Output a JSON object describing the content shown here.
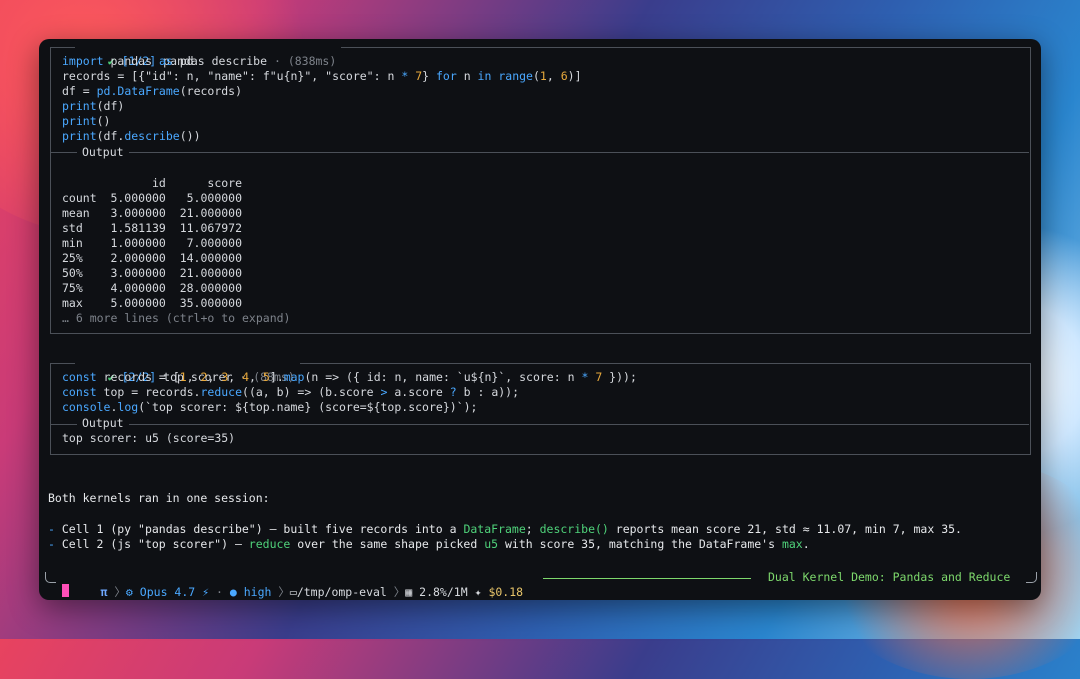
{
  "cell1": {
    "check": "✔",
    "step": "[1/2]",
    "title": "pandas describe",
    "dot": "·",
    "time": "(838ms)",
    "output_label": "Output",
    "code": [
      [
        [
          "import",
          "kw"
        ],
        [
          " pandas ",
          ""
        ],
        [
          "as",
          "kw"
        ],
        [
          " pd",
          ""
        ]
      ],
      [
        [
          "records = [{",
          ""
        ],
        [
          "\"id\"",
          ""
        ],
        [
          ": n, ",
          ""
        ],
        [
          "\"name\"",
          ""
        ],
        [
          ": f\"u{n}\", ",
          ""
        ],
        [
          "\"score\"",
          ""
        ],
        [
          ": n ",
          ""
        ],
        [
          "*",
          "kw"
        ],
        [
          " ",
          ""
        ],
        [
          "7",
          "num"
        ],
        [
          "} ",
          ""
        ],
        [
          "for",
          "kw"
        ],
        [
          " n ",
          ""
        ],
        [
          "in",
          "kw"
        ],
        [
          " ",
          ""
        ],
        [
          "range",
          "fn"
        ],
        [
          "(",
          ""
        ],
        [
          "1",
          "num"
        ],
        [
          ", ",
          ""
        ],
        [
          "6",
          "num"
        ],
        [
          ")]",
          ""
        ]
      ],
      [
        [
          "df = ",
          ""
        ],
        [
          "pd.DataFrame",
          "fn"
        ],
        [
          "(records)",
          ""
        ]
      ],
      [
        [
          "print",
          "fn"
        ],
        [
          "(df)",
          ""
        ]
      ],
      [
        [
          "print",
          "fn"
        ],
        [
          "()",
          ""
        ]
      ],
      [
        [
          "print",
          "fn"
        ],
        [
          "(df.",
          ""
        ],
        [
          "describe",
          "fn"
        ],
        [
          "())",
          ""
        ]
      ]
    ],
    "output_lines": [
      "",
      "             id      score",
      "count  5.000000   5.000000",
      "mean   3.000000  21.000000",
      "std    1.581139  11.067972",
      "min    1.000000   7.000000",
      "25%    2.000000  14.000000",
      "50%    3.000000  21.000000",
      "75%    4.000000  28.000000",
      "max    5.000000  35.000000"
    ],
    "more_lines": "… 6 more lines (ctrl+o to expand)"
  },
  "cell2": {
    "check": "✔",
    "step": "[2/2]",
    "title": "top scorer",
    "dot": "·",
    "time": "(88ms)",
    "output_label": "Output",
    "code": [
      [
        [
          "const",
          "kw"
        ],
        [
          " records = [",
          ""
        ],
        [
          "1",
          "num"
        ],
        [
          ", ",
          ""
        ],
        [
          "2",
          "num"
        ],
        [
          ", ",
          ""
        ],
        [
          "3",
          "num"
        ],
        [
          ", ",
          ""
        ],
        [
          "4",
          "num"
        ],
        [
          ", ",
          ""
        ],
        [
          "5",
          "num"
        ],
        [
          "].",
          ""
        ],
        [
          "map",
          "fn"
        ],
        [
          "(n => ({ id: n, name: `u${n}`, score: n ",
          ""
        ],
        [
          "*",
          "kw"
        ],
        [
          " ",
          ""
        ],
        [
          "7",
          "num"
        ],
        [
          " }));",
          ""
        ]
      ],
      [
        [
          "const",
          "kw"
        ],
        [
          " top = records.",
          ""
        ],
        [
          "reduce",
          "fn"
        ],
        [
          "((a, b) => (b.score ",
          ""
        ],
        [
          ">",
          "kw"
        ],
        [
          " a.score ",
          ""
        ],
        [
          "?",
          "kw"
        ],
        [
          " b : a));",
          ""
        ]
      ],
      [
        [
          "console",
          "kw"
        ],
        [
          ".",
          ""
        ],
        [
          "log",
          "fn"
        ],
        [
          "(`top scorer: ${top.name} (score=${top.score})`);",
          ""
        ]
      ]
    ],
    "output_lines": [
      "top scorer: u5 (score=35)"
    ]
  },
  "summary": {
    "heading": "Both kernels ran in one session:",
    "bullets": [
      [
        [
          "- ",
          "blue"
        ],
        [
          "Cell 1 (py \"pandas describe\") — built five records into a ",
          ""
        ],
        [
          "DataFrame",
          "hl"
        ],
        [
          "; ",
          ""
        ],
        [
          "describe()",
          "hl"
        ],
        [
          " reports mean score 21, std ≈ 11.07, min 7, max 35.",
          ""
        ]
      ],
      [
        [
          "- ",
          "blue"
        ],
        [
          "Cell 2 (js \"top scorer\") — ",
          ""
        ],
        [
          "reduce",
          "hl"
        ],
        [
          " over the same shape picked ",
          ""
        ],
        [
          "u5",
          "hl"
        ],
        [
          " with score 35, matching the DataFrame's ",
          ""
        ],
        [
          "max",
          "hl"
        ],
        [
          ".",
          ""
        ]
      ]
    ]
  },
  "statusbar": {
    "pi": "π",
    "model": "Opus 4.7",
    "effort": "high",
    "path": "/tmp/omp-eval",
    "context": "2.8%/1M",
    "cost": "$0.18",
    "session_title": "Dual Kernel Demo: Pandas and Reduce"
  },
  "colors": {
    "accent_green": "#4fd27a",
    "keyword_blue": "#4aa8ff",
    "number_orange": "#e8a93c",
    "cursor_pink": "#ff4fb8"
  }
}
